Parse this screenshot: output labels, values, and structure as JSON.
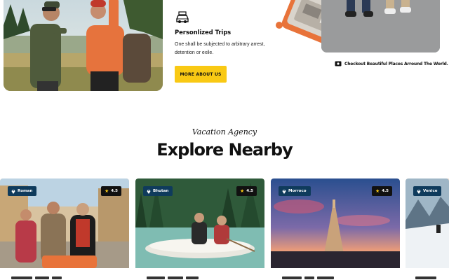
{
  "trips": {
    "title": "Personlized Trips",
    "text": "One shall be subjected to arbitrary arrest, detention or exile.",
    "icon": "car-icon"
  },
  "more_button": {
    "label": "MORE ABOUT US"
  },
  "checkout": {
    "text": "Checkout Beautiful Places Arround The World.",
    "icon": "map-icon"
  },
  "heading": {
    "eyebrow": "Vacation Agency",
    "title": "Explore Nearby"
  },
  "cards": [
    {
      "location": "Roman",
      "rating": "4.5"
    },
    {
      "location": "Bhutan",
      "rating": "4.5"
    },
    {
      "location": "Morroco",
      "rating": "4.5"
    },
    {
      "location": "Venice",
      "rating": ""
    }
  ],
  "colors": {
    "accent": "#f9c914",
    "badge": "#0f3b5c",
    "card_bg": "#f7e2d2"
  }
}
